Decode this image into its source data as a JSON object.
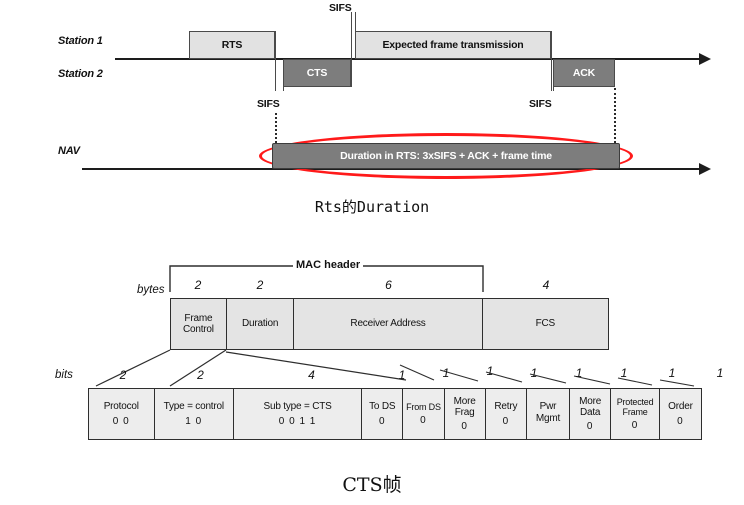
{
  "timing_diagram": {
    "rows": [
      {
        "label": "Station 1"
      },
      {
        "label": "Station 2"
      },
      {
        "label": "NAV"
      }
    ],
    "frames": [
      {
        "name": "RTS",
        "label": "RTS",
        "style": "light",
        "row": "Station 1"
      },
      {
        "name": "CTS",
        "label": "CTS",
        "style": "dark",
        "row": "Station 2"
      },
      {
        "name": "expected-frame",
        "label": "Expected frame transmission",
        "style": "light",
        "row": "Station 1"
      },
      {
        "name": "ACK",
        "label": "ACK",
        "style": "dark",
        "row": "Station 2"
      }
    ],
    "sifs_labels": [
      {
        "id": "sifs-top",
        "label": "SIFS"
      },
      {
        "id": "sifs-left",
        "label": "SIFS"
      },
      {
        "id": "sifs-right",
        "label": "SIFS"
      }
    ],
    "nav_bar": {
      "label": "Duration in RTS: 3xSIFS + ACK + frame time",
      "highlight_color": "#ff1a1a",
      "fill_color": "#7d7d7d",
      "text_color": "#ffffff"
    }
  },
  "caption_top": "Rts的Duration",
  "caption_bottom": "CTS帧",
  "frame_format": {
    "bytes_label": "bytes",
    "bits_label": "bits",
    "mac_header_label": "MAC header",
    "byte_fields": [
      {
        "name": "frame-control",
        "label": "Frame\nControl",
        "size": "2",
        "in_mac_header": true
      },
      {
        "name": "duration",
        "label": "Duration",
        "size": "2",
        "in_mac_header": true
      },
      {
        "name": "receiver-address",
        "label": "Receiver Address",
        "size": "6",
        "in_mac_header": true
      },
      {
        "name": "fcs",
        "label": "FCS",
        "size": "4",
        "in_mac_header": false
      }
    ],
    "bit_fields": [
      {
        "name": "protocol",
        "label": "Protocol",
        "size": "2",
        "value": "0     0"
      },
      {
        "name": "type",
        "label": "Type = control",
        "size": "2",
        "value": "1     0"
      },
      {
        "name": "sub-type",
        "label": "Sub type = CTS",
        "size": "4",
        "value": "0   0   1   1"
      },
      {
        "name": "to-ds",
        "label": "To DS",
        "size": "1",
        "value": "0"
      },
      {
        "name": "from-ds",
        "label": "From DS",
        "size": "1",
        "value": "0"
      },
      {
        "name": "more-frag",
        "label": "More\nFrag",
        "size": "1",
        "value": "0"
      },
      {
        "name": "retry",
        "label": "Retry",
        "size": "1",
        "value": "0"
      },
      {
        "name": "pwr-mgmt",
        "label": "Pwr\nMgmt",
        "size": "1",
        "value": ""
      },
      {
        "name": "more-data",
        "label": "More\nData",
        "size": "1",
        "value": "0"
      },
      {
        "name": "protected-frame",
        "label": "Protected\nFrame",
        "size": "1",
        "value": "0"
      },
      {
        "name": "order",
        "label": "Order",
        "size": "1",
        "value": "0"
      }
    ]
  }
}
